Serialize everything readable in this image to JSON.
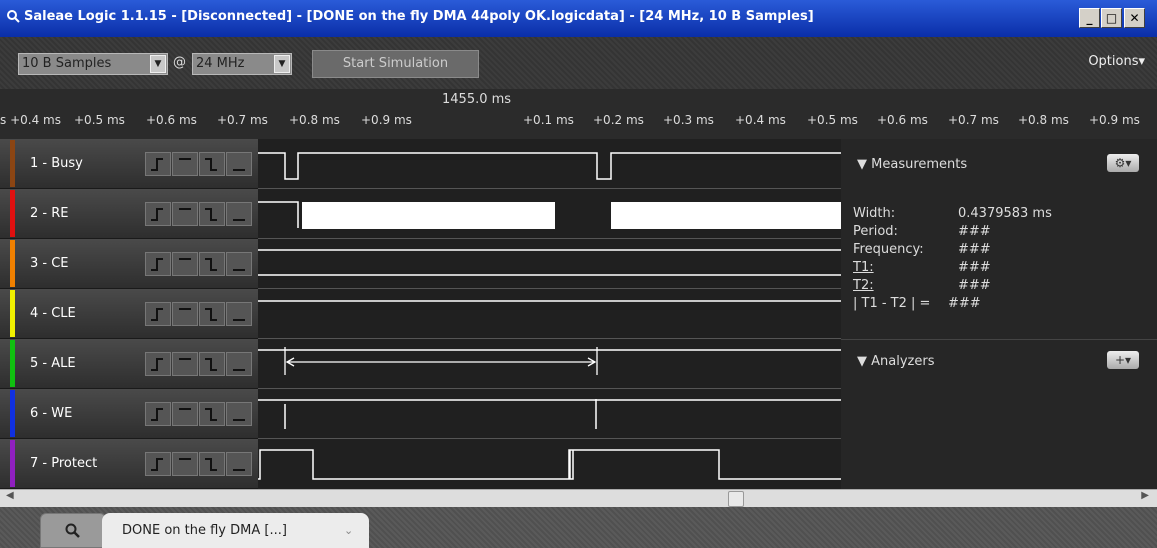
{
  "window": {
    "title": "Saleae Logic 1.1.15 - [Disconnected] - [DONE on the fly DMA 44poly OK.logicdata] - [24 MHz, 10 B Samples]",
    "minimize": "_",
    "maximize": "□",
    "close": "✕"
  },
  "toolbar": {
    "samples_value": "10 B Samples",
    "at_symbol": "@",
    "rate_value": "24 MHz",
    "start_label": "Start Simulation",
    "options_label": "Options▾"
  },
  "ruler": {
    "center_time": "1455.0 ms",
    "ticks_left": [
      "s +0.4 ms",
      "+0.5 ms",
      "+0.6 ms",
      "+0.7 ms",
      "+0.8 ms",
      "+0.9 ms"
    ],
    "ticks_right": [
      "+0.1 ms",
      "+0.2 ms",
      "+0.3 ms",
      "+0.4 ms",
      "+0.5 ms",
      "+0.6 ms",
      "+0.7 ms",
      "+0.8 ms",
      "+0.9 ms"
    ]
  },
  "channels": [
    {
      "label": "1 - Busy",
      "color": "#8B4513"
    },
    {
      "label": "2 - RE",
      "color": "#E01010"
    },
    {
      "label": "3 - CE",
      "color": "#F08000"
    },
    {
      "label": "4 - CLE",
      "color": "#F0F000"
    },
    {
      "label": "5 - ALE",
      "color": "#10C010"
    },
    {
      "label": "6 - WE",
      "color": "#1030E0"
    },
    {
      "label": "7 - Protect",
      "color": "#9020C0"
    }
  ],
  "trigger_icons": [
    "rising-edge-icon",
    "high-level-icon",
    "falling-edge-icon",
    "low-level-icon"
  ],
  "measurements": {
    "header": "Measurements",
    "rows": [
      {
        "label": "Width:",
        "value": "0.4379583 ms"
      },
      {
        "label": "Period:",
        "value": "###"
      },
      {
        "label": "Frequency:",
        "value": "###"
      },
      {
        "label": "T1:",
        "value": "###"
      },
      {
        "label": "T2:",
        "value": "###"
      },
      {
        "label": "| T1 - T2 | =",
        "value": "###"
      }
    ]
  },
  "analyzers": {
    "header": "Analyzers",
    "add_button": "+▾"
  },
  "measurements_button": "⚙▾",
  "tabs": {
    "document_tab": "DONE on the fly DMA [...]",
    "dropdown": "⌄"
  }
}
